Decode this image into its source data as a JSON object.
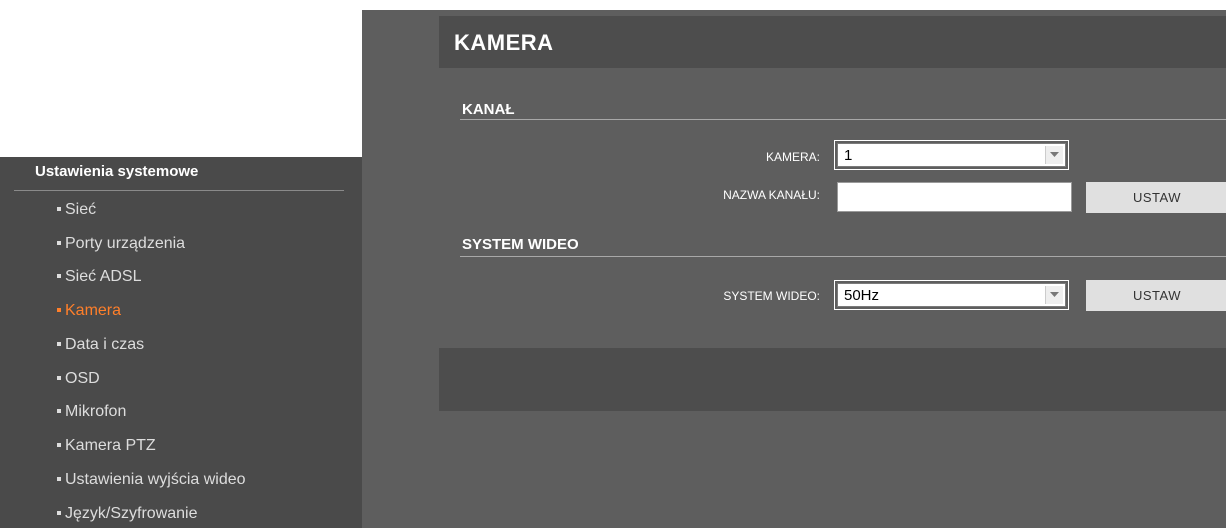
{
  "sidebar": {
    "title": "Ustawienia systemowe",
    "items": [
      {
        "label": "Sieć",
        "active": false
      },
      {
        "label": "Porty urządzenia",
        "active": false
      },
      {
        "label": "Sieć ADSL",
        "active": false
      },
      {
        "label": "Kamera",
        "active": true
      },
      {
        "label": "Data i czas",
        "active": false
      },
      {
        "label": "OSD",
        "active": false
      },
      {
        "label": "Mikrofon",
        "active": false
      },
      {
        "label": "Kamera PTZ",
        "active": false
      },
      {
        "label": "Ustawienia wyjścia wideo",
        "active": false
      },
      {
        "label": "Język/Szyfrowanie",
        "active": false
      }
    ]
  },
  "header": {
    "title": "KAMERA"
  },
  "channel_section": {
    "title": "KANAŁ",
    "camera_label": "KAMERA:",
    "camera_value": "1",
    "name_label": "NAZWA KANAŁU:",
    "name_value": "",
    "set_button": "USTAW"
  },
  "video_section": {
    "title": "SYSTEM WIDEO",
    "system_label": "SYSTEM WIDEO:",
    "system_value": "50Hz",
    "set_button": "USTAW"
  },
  "colors": {
    "accent": "#ff7f2a",
    "sidebar_bg": "#4a4a4a",
    "main_bg": "#5e5e5e",
    "header_bg": "#4d4d4d"
  }
}
